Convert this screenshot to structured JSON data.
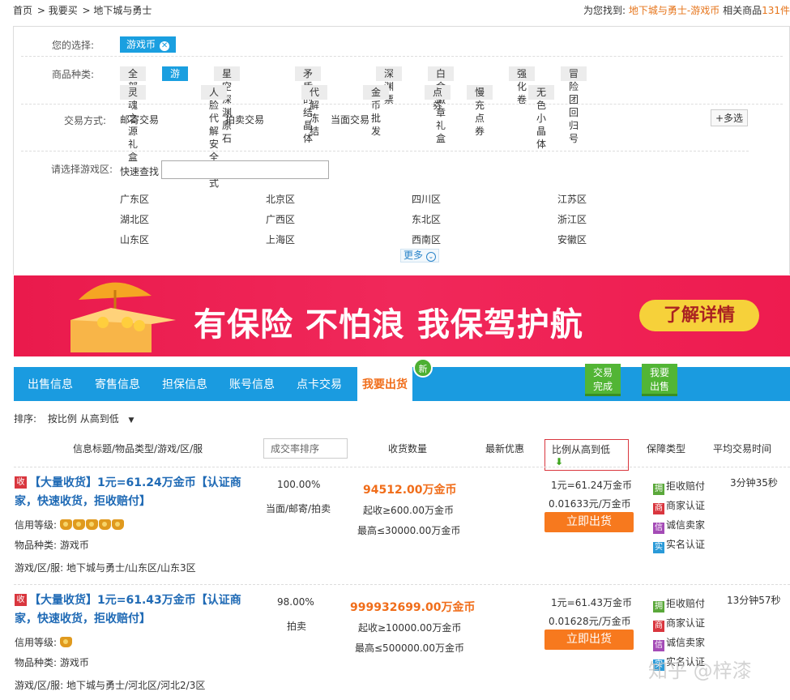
{
  "breadcrumb": [
    "首页",
    "我要买",
    "地下城与勇士"
  ],
  "found": {
    "prefix": "为您找到:",
    "query": "地下城与勇士-游戏币",
    "middle": "相关商品",
    "count": "131件"
  },
  "filter": {
    "selection_label": "您的选择:",
    "selection_chip": "游戏币",
    "category_label": "商品种类:",
    "categories_row1": [
      "全部",
      "游戏币",
      "星空深渊原石",
      "矛盾的结晶体",
      "深渊票",
      "白金徽章礼盒",
      "强化卷",
      "冒险团回归号"
    ],
    "categories_row2": [
      "灵魂之源礼盒",
      "人脸代解安全模式",
      "代解冻结",
      "金币批发",
      "点券",
      "慢充点券",
      "无色小晶体"
    ],
    "trade_label": "交易方式:",
    "trade_methods": [
      "邮寄交易",
      "拍卖交易",
      "当面交易"
    ],
    "multi_select": "+多选",
    "region_label": "请选择游戏区:",
    "quick_search": "快速查找",
    "regions": [
      "广东区",
      "北京区",
      "四川区",
      "江苏区",
      "湖北区",
      "广西区",
      "东北区",
      "浙江区",
      "山东区",
      "上海区",
      "西南区",
      "安徽区"
    ],
    "more": "更多"
  },
  "banner": {
    "text": "有保险 不怕浪 我保驾护航",
    "button": "了解详情"
  },
  "tabs": [
    "出售信息",
    "寄售信息",
    "担保信息",
    "账号信息",
    "点卡交易",
    "我要出货"
  ],
  "new_badge": "新",
  "side_buttons": [
    "交易\n完成",
    "我要\n出售"
  ],
  "sort": {
    "label": "排序:",
    "value": "按比例 从高到低",
    "arrow": "▼"
  },
  "columns": {
    "info": "信息标题/物品类型/游戏/区/服",
    "rate_sort": "成交率排序",
    "qty": "收货数量",
    "discount": "最新优惠",
    "ratio_sort": "比例从高到低",
    "guarantee": "保障类型",
    "avg_time": "平均交易时间"
  },
  "listings": [
    {
      "tag": "收",
      "title_line1": "【大量收货】1元=61.24万金币【认证商",
      "title_line2": "家，快速收货，拒收赔付】",
      "credit_label": "信用等级:",
      "crowns": 5,
      "item_type": "物品种类:  游戏币",
      "server": "游戏/区/服:  地下城与勇士/山东区/山东3区",
      "rate": "100.00%",
      "method": "当面/邮寄/拍卖",
      "qty": "94512.00万金币",
      "min": "起收≥600.00万金币",
      "max": "最高≤30000.00万金币",
      "ratio1": "1元=61.24万金币",
      "ratio2": "0.01633元/万金币",
      "button": "立即出货",
      "guarantees": [
        "拒收赔付",
        "商家认证",
        "诚信卖家",
        "实名认证"
      ],
      "time": "3分钟35秒"
    },
    {
      "tag": "收",
      "title_line1": "【大量收货】1元=61.43万金币【认证商",
      "title_line2": "家，快速收货，拒收赔付】",
      "credit_label": "信用等级:",
      "crowns": 1,
      "item_type": "物品种类:  游戏币",
      "server": "游戏/区/服:  地下城与勇士/河北区/河北2/3区",
      "rate": "98.00%",
      "method": "拍卖",
      "qty": "999932699.00万金币",
      "min": "起收≥10000.00万金币",
      "max": "最高≤500000.00万金币",
      "ratio1": "1元=61.43万金币",
      "ratio2": "0.01628元/万金币",
      "button": "立即出货",
      "guarantees": [
        "拒收赔付",
        "商家认证",
        "诚信卖家",
        "实名认证"
      ],
      "time": "13分钟57秒"
    }
  ],
  "guarantee_icons": [
    "拥",
    "商",
    "信",
    "实"
  ],
  "watermark": "知乎 @梓漆"
}
